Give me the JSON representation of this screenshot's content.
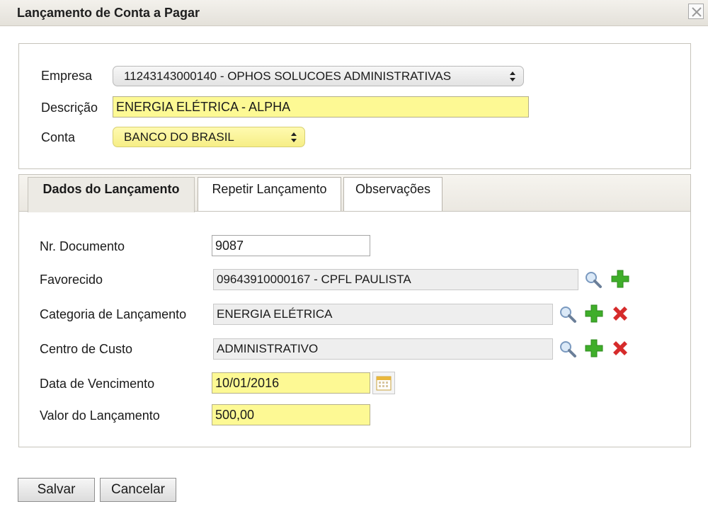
{
  "window": {
    "title": "Lançamento de Conta a Pagar"
  },
  "header_fields": {
    "empresa_label": "Empresa",
    "empresa_value": "11243143000140 - OPHOS SOLUCOES ADMINISTRATIVAS",
    "descricao_label": "Descrição",
    "descricao_value": "ENERGIA ELÉTRICA - ALPHA",
    "conta_label": "Conta",
    "conta_value": "BANCO DO BRASIL"
  },
  "tabs": [
    {
      "label": "Dados do Lançamento",
      "active": true
    },
    {
      "label": "Repetir Lançamento",
      "active": false
    },
    {
      "label": "Observações",
      "active": false
    }
  ],
  "form": {
    "nr_documento_label": "Nr. Documento",
    "nr_documento_value": "9087",
    "favorecido_label": "Favorecido",
    "favorecido_value": "09643910000167 - CPFL PAULISTA",
    "categoria_label": "Categoria de Lançamento",
    "categoria_value": "ENERGIA ELÉTRICA",
    "centro_custo_label": "Centro de Custo",
    "centro_custo_value": "ADMINISTRATIVO",
    "data_vencimento_label": "Data de Vencimento",
    "data_vencimento_value": "10/01/2016",
    "valor_label": "Valor do Lançamento",
    "valor_value": "500,00"
  },
  "buttons": {
    "save_label": "Salvar",
    "cancel_label": "Cancelar"
  },
  "colors": {
    "required_field": "#fdf994",
    "add_icon": "#3fae2a",
    "remove_icon": "#d62b2b"
  }
}
